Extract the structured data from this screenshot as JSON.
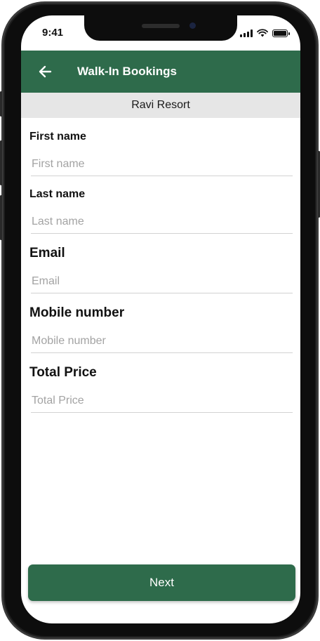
{
  "status_bar": {
    "time": "9:41"
  },
  "app_bar": {
    "title": "Walk-In Bookings",
    "color": "#2e6b4b"
  },
  "resort": {
    "name": "Ravi Resort"
  },
  "form": {
    "fields": [
      {
        "label": "First name",
        "placeholder": "First name",
        "value": ""
      },
      {
        "label": "Last name",
        "placeholder": "Last name",
        "value": ""
      },
      {
        "label": "Email",
        "placeholder": "Email",
        "value": ""
      },
      {
        "label": "Mobile number",
        "placeholder": "Mobile number",
        "value": ""
      },
      {
        "label": "Total Price",
        "placeholder": "Total Price",
        "value": ""
      }
    ]
  },
  "actions": {
    "next_label": "Next"
  },
  "icons": {
    "back": "arrow-left-icon"
  }
}
